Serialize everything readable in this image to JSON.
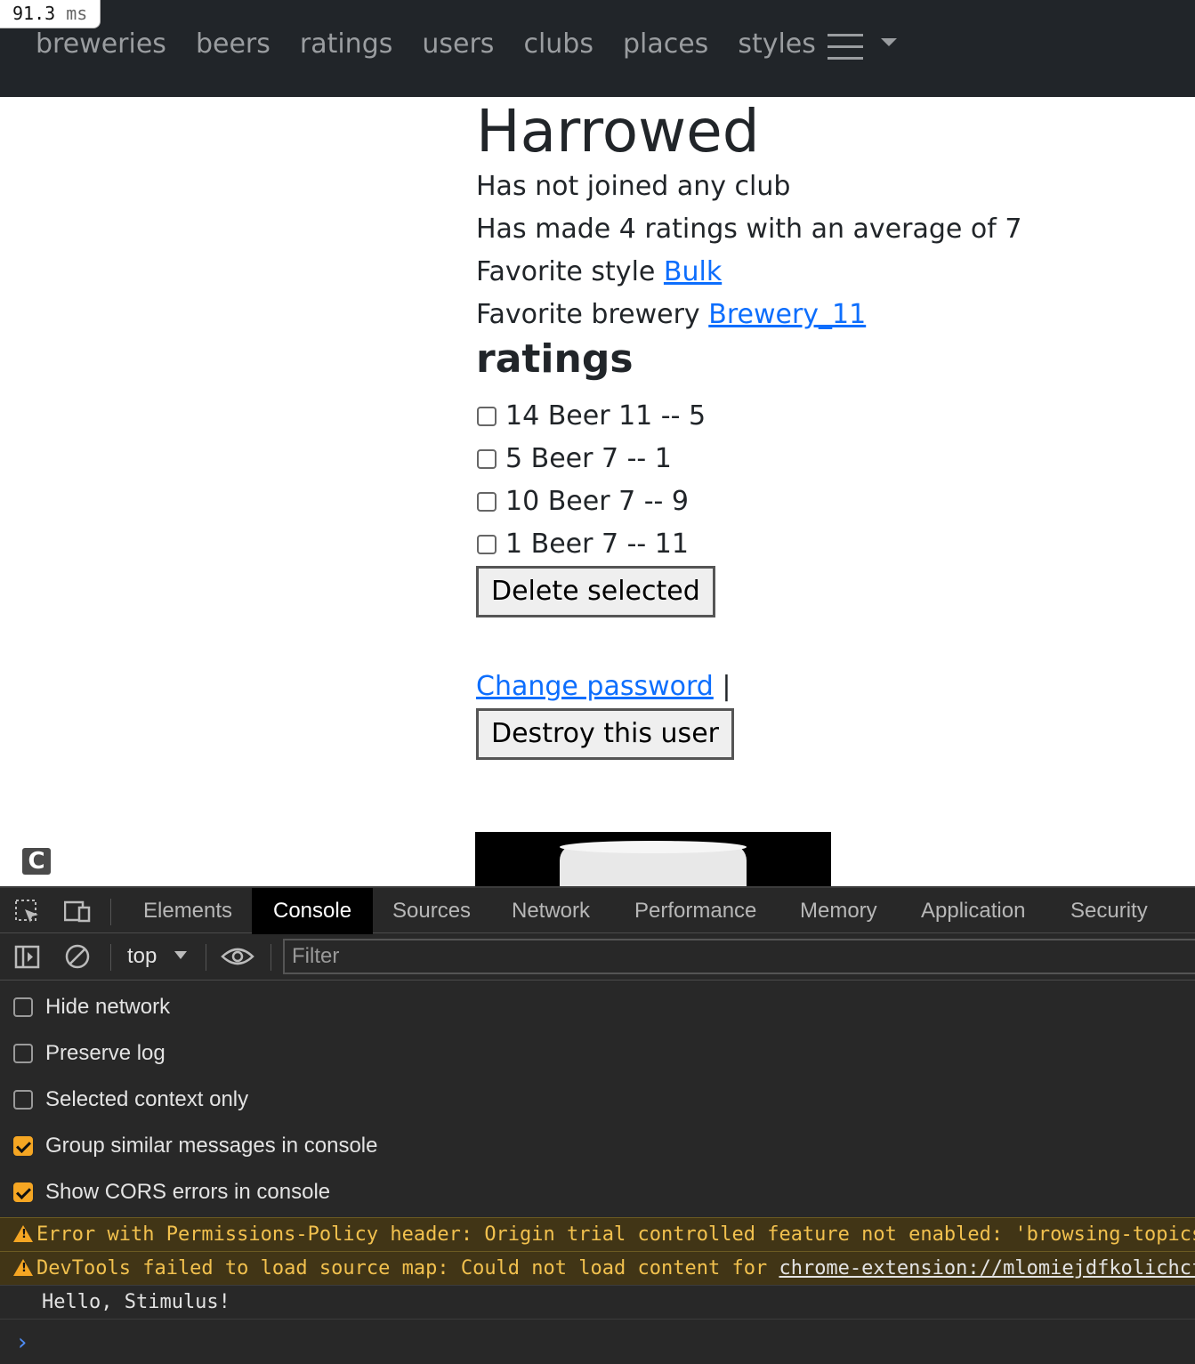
{
  "profiler": {
    "value": "91.3",
    "unit": "ms"
  },
  "nav": {
    "links": [
      "breweries",
      "beers",
      "ratings",
      "users",
      "clubs",
      "places",
      "styles"
    ]
  },
  "user": {
    "name": "Harrowed",
    "clubs_text": "Has not joined any club",
    "ratings_summary": "Has made 4 ratings with an average of 7",
    "favorite_style_label": "Favorite style",
    "favorite_style": "Bulk",
    "favorite_brewery_label": "Favorite brewery",
    "favorite_brewery": "Brewery_11"
  },
  "ratings": {
    "heading": "ratings",
    "items": [
      "14 Beer 11 -- 5",
      "5 Beer 7 -- 1",
      "10 Beer 7 -- 9",
      "1 Beer 7 -- 11"
    ],
    "delete_button": "Delete selected"
  },
  "actions": {
    "change_password": "Change password",
    "separator": "|",
    "destroy_button": "Destroy this user"
  },
  "corner_icon": "C",
  "devtools": {
    "tabs": [
      "Elements",
      "Console",
      "Sources",
      "Network",
      "Performance",
      "Memory",
      "Application",
      "Security"
    ],
    "active_tab": "Console",
    "context": "top",
    "filter_placeholder": "Filter",
    "options": [
      {
        "label": "Hide network",
        "checked": false
      },
      {
        "label": "Preserve log",
        "checked": false
      },
      {
        "label": "Selected context only",
        "checked": false
      },
      {
        "label": "Group similar messages in console",
        "checked": true
      },
      {
        "label": "Show CORS errors in console",
        "checked": true
      }
    ],
    "messages": {
      "warn1": "Error with Permissions-Policy header: Origin trial controlled feature not enabled: 'browsing-topics'.",
      "warn2_prefix": "DevTools failed to load source map: Could not load content for ",
      "warn2_link": "chrome-extension://mlomiejdfkolichcflejclcbmpeaniij/",
      "log": "Hello, Stimulus!"
    },
    "prompt": "›"
  }
}
